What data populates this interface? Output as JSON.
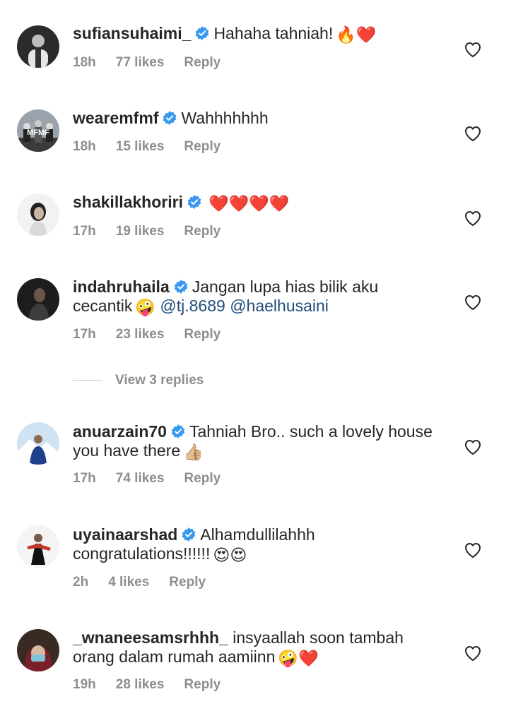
{
  "comments": [
    {
      "username": "sufiansuhaimi_",
      "text": "Hahaha tahniah!",
      "emojis": "🔥❤️",
      "mentions": "",
      "time": "18h",
      "likes": "77 likes",
      "reply": "Reply"
    },
    {
      "username": "wearemfmf",
      "text": "Wahhhhhhh",
      "emojis": "",
      "mentions": "",
      "time": "18h",
      "likes": "15 likes",
      "reply": "Reply",
      "avatar_text": "MFMF"
    },
    {
      "username": "shakillakhoriri",
      "text": "",
      "emojis": "❤️❤️❤️❤️",
      "mentions": "",
      "time": "17h",
      "likes": "19 likes",
      "reply": "Reply"
    },
    {
      "username": "indahruhaila",
      "text": "Jangan lupa hias bilik aku cecantik",
      "emojis": "🤪",
      "mentions": "@tj.8689 @haelhusaini",
      "time": "17h",
      "likes": "23 likes",
      "reply": "Reply"
    },
    {
      "username": "anuarzain70",
      "text": "Tahniah Bro.. such a lovely house you have there",
      "emojis": "👍🏼",
      "mentions": "",
      "time": "17h",
      "likes": "74 likes",
      "reply": "Reply"
    },
    {
      "username": "uyainaarshad",
      "text": "Alhamdullilahhh congratulations!!!!!!",
      "emojis": "😍😍",
      "mentions": "",
      "time": "2h",
      "likes": "4 likes",
      "reply": "Reply"
    },
    {
      "username": "_wnaneesamsrhhh_",
      "text": "insyaallah soon tambah orang dalam rumah aamiinn",
      "emojis": "🤪❤️",
      "mentions": "",
      "time": "19h",
      "likes": "28 likes",
      "reply": "Reply"
    }
  ],
  "view_replies": "View 3 replies",
  "colors": {
    "verified": "#3897f0",
    "meta": "#8e8e8e",
    "mention": "#1f4d7a",
    "heart_outline": "#262626"
  },
  "icons": {
    "verified": "verified-badge-icon",
    "like": "heart-outline-icon"
  }
}
